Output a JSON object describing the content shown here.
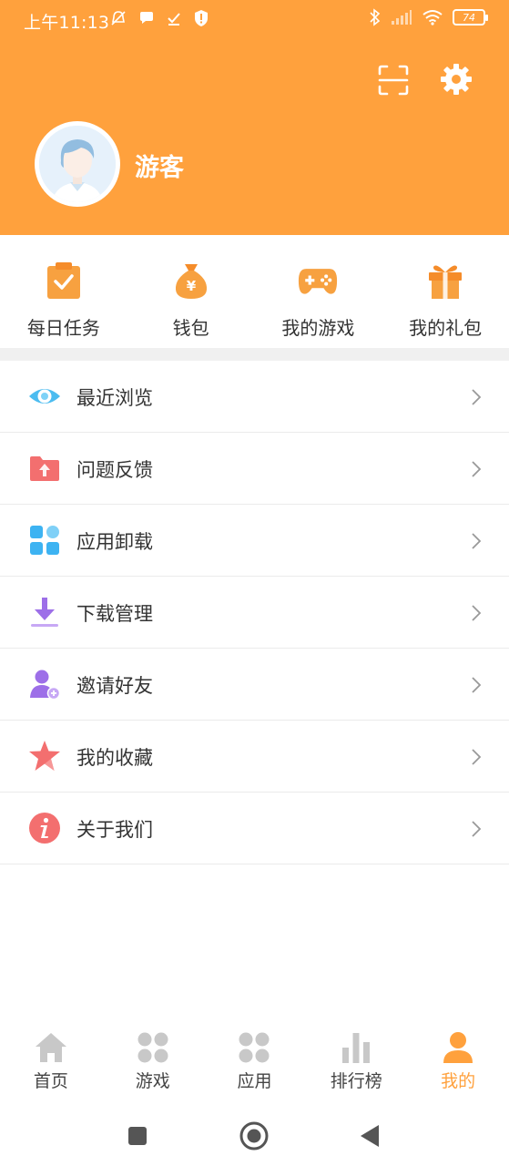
{
  "status_bar": {
    "time": "上午11:13",
    "battery": "74"
  },
  "profile": {
    "username": "游客"
  },
  "quick_actions": [
    {
      "label": "每日任务",
      "icon": "clipboard-check-icon"
    },
    {
      "label": "钱包",
      "icon": "money-bag-icon"
    },
    {
      "label": "我的游戏",
      "icon": "gamepad-icon"
    },
    {
      "label": "我的礼包",
      "icon": "gift-icon"
    }
  ],
  "menu": [
    {
      "label": "最近浏览",
      "icon": "eye-icon"
    },
    {
      "label": "问题反馈",
      "icon": "folder-upload-icon"
    },
    {
      "label": "应用卸载",
      "icon": "app-grid-icon"
    },
    {
      "label": "下载管理",
      "icon": "download-icon"
    },
    {
      "label": "邀请好友",
      "icon": "add-user-icon"
    },
    {
      "label": "我的收藏",
      "icon": "star-icon"
    },
    {
      "label": "关于我们",
      "icon": "info-icon"
    }
  ],
  "tabs": [
    {
      "label": "首页",
      "icon": "home-icon",
      "active": false
    },
    {
      "label": "游戏",
      "icon": "games-grid-icon",
      "active": false
    },
    {
      "label": "应用",
      "icon": "apps-grid-icon",
      "active": false
    },
    {
      "label": "排行榜",
      "icon": "bar-chart-icon",
      "active": false
    },
    {
      "label": "我的",
      "icon": "person-icon",
      "active": true
    }
  ],
  "colors": {
    "brand": "#ffa13d",
    "divider": "#ebebeb"
  }
}
